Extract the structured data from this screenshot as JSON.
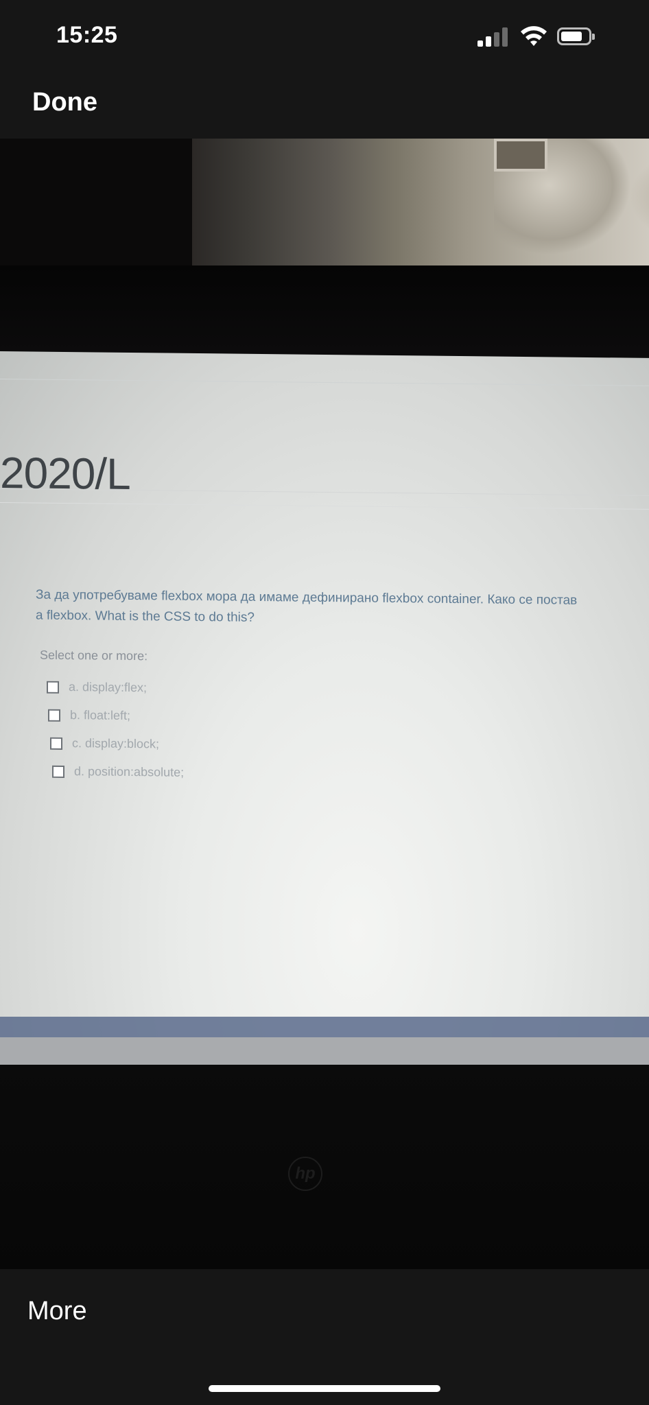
{
  "status_bar": {
    "time": "15:25",
    "icons": [
      "cellular-signal-icon",
      "wifi-icon",
      "battery-icon"
    ]
  },
  "nav": {
    "done_label": "Done"
  },
  "photo_content": {
    "course_heading": "2020/L",
    "question_line1": "За да употребуваме flexbox мора да имаме дефинирано flexbox container. Како се постав",
    "question_line2": "a flexbox. What is the CSS to do this?",
    "select_label": "Select one or more:",
    "options": [
      {
        "label": "a. display:flex;"
      },
      {
        "label": "b. float:left;"
      },
      {
        "label": "c. display:block;"
      },
      {
        "label": "d. position:absolute;"
      }
    ],
    "brand_mark": "hp"
  },
  "toolbar": {
    "more_label": "More"
  },
  "colors": {
    "bars_background": "#161616",
    "question_text": "#5d7a93",
    "option_text": "#a2a8ad"
  }
}
